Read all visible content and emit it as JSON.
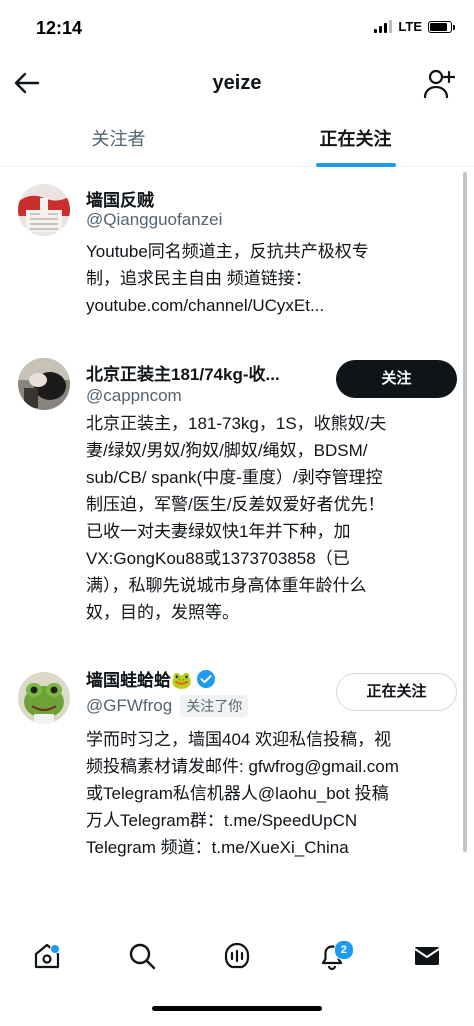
{
  "status_bar": {
    "time": "12:14",
    "network": "LTE",
    "battery_level": 0.85
  },
  "header": {
    "title": "yeize",
    "back_icon": "arrow-left-icon",
    "add_user_icon": "person-plus-icon"
  },
  "tabs": [
    {
      "label": "关注者",
      "active": false
    },
    {
      "label": "正在关注",
      "active": true
    }
  ],
  "users": [
    {
      "name": "墙国反贼",
      "handle": "@Qiangguofanzei",
      "bio": "Youtube同名频道主，反抗共产极权专\n制，追求民主自由 频道链接：\nyoutube.com/channel/UCyxEt..."
    },
    {
      "name": "北京正装主181/74kg-收...",
      "handle": "@cappncom",
      "button_label": "关注",
      "bio": "北京正装主，181-73kg，1S，收熊奴/夫\n妻/绿奴/男奴/狗奴/脚奴/绳奴，BDSM/\nsub/CB/ spank(中度-重度）/剥夺管理控\n制压迫，军警/医生/反差奴爱好者优先！\n已收一对夫妻绿奴快1年并下种，加\nVX:GongKou88或1373703858（已\n满），私聊先说城市身高体重年龄什么\n奴，目的，发照等。"
    },
    {
      "name": "墙国蛙蛤蛤🐸",
      "handle": "@GFWfrog",
      "follows_you_label": "关注了你",
      "button_label": "正在关注",
      "verified": true,
      "bio": "学而时习之，墙国404 欢迎私信投稿，视\n频投稿素材请发邮件: gfwfrog@gmail.com\n或Telegram私信机器人@laohu_bot 投稿\n万人Telegram群：t.me/SpeedUpCN\nTelegram 频道：t.me/XueXi_China"
    }
  ],
  "bottom_nav": {
    "items": [
      "home-icon",
      "search-icon",
      "spaces-icon",
      "bell-icon",
      "mail-icon"
    ],
    "notification_count": "2"
  },
  "colors": {
    "accent": "#1d9bf0",
    "text": "#0f1419",
    "secondary": "#536471"
  }
}
